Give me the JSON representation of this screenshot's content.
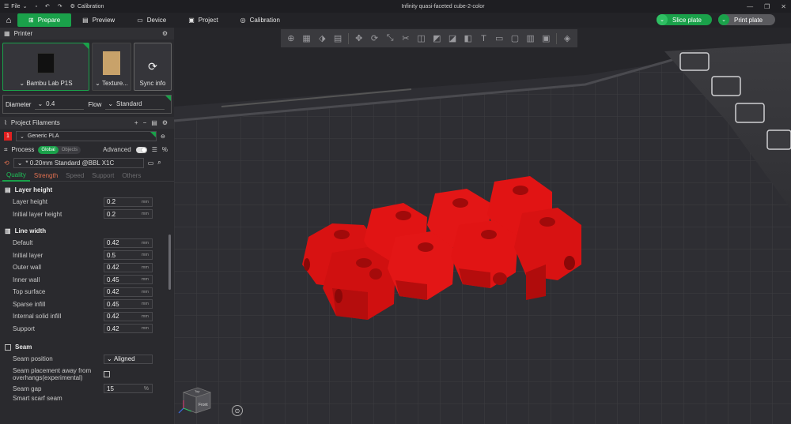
{
  "titlebar": {
    "file_label": "File",
    "calibration_label": "Calibration",
    "doc_title": "Infinity quasi-faceted cube-2-color"
  },
  "tabs": [
    {
      "label": "Prepare",
      "active": true
    },
    {
      "label": "Preview",
      "active": false
    },
    {
      "label": "Device",
      "active": false
    },
    {
      "label": "Project",
      "active": false
    },
    {
      "label": "Calibration",
      "active": false
    }
  ],
  "actions": {
    "slice_label": "Slice plate",
    "print_label": "Print plate"
  },
  "printer": {
    "header": "Printer",
    "printer_name": "Bambu Lab P1S",
    "plate_name": "Texture...",
    "sync_label": "Sync info",
    "diameter_label": "Diameter",
    "diameter_value": "0.4",
    "flow_label": "Flow",
    "flow_value": "Standard"
  },
  "filaments": {
    "header": "Project Filaments",
    "items": [
      {
        "index": "1",
        "name": "Generic PLA",
        "color": "#e02020"
      }
    ]
  },
  "process": {
    "header": "Process",
    "toggle_on": "Global",
    "toggle_off": "Objects",
    "advanced_label": "Advanced",
    "preset": "* 0.20mm Standard @BBL X1C",
    "subtabs": [
      "Quality",
      "Strength",
      "Speed",
      "Support",
      "Others"
    ],
    "groups": [
      {
        "title": "Layer height",
        "params": [
          {
            "label": "Layer height",
            "value": "0.2",
            "unit": "mm"
          },
          {
            "label": "Initial layer height",
            "value": "0.2",
            "unit": "mm"
          }
        ]
      },
      {
        "title": "Line width",
        "params": [
          {
            "label": "Default",
            "value": "0.42",
            "unit": "mm"
          },
          {
            "label": "Initial layer",
            "value": "0.5",
            "unit": "mm"
          },
          {
            "label": "Outer wall",
            "value": "0.42",
            "unit": "mm"
          },
          {
            "label": "Inner wall",
            "value": "0.45",
            "unit": "mm"
          },
          {
            "label": "Top surface",
            "value": "0.42",
            "unit": "mm"
          },
          {
            "label": "Sparse infill",
            "value": "0.45",
            "unit": "mm"
          },
          {
            "label": "Internal solid infill",
            "value": "0.42",
            "unit": "mm"
          },
          {
            "label": "Support",
            "value": "0.42",
            "unit": "mm"
          }
        ]
      }
    ],
    "seam": {
      "title": "Seam",
      "position_label": "Seam position",
      "position_value": "Aligned",
      "away_label_1": "Seam placement away from",
      "away_label_2": "overhangs(experimental)",
      "gap_label": "Seam gap",
      "gap_value": "15",
      "gap_unit": "%",
      "scarf_label": "Smart scarf seam"
    }
  },
  "viewport": {
    "nav_cube_label": "Front",
    "nav_cube_top": "Top",
    "model_color": "#e11414"
  }
}
